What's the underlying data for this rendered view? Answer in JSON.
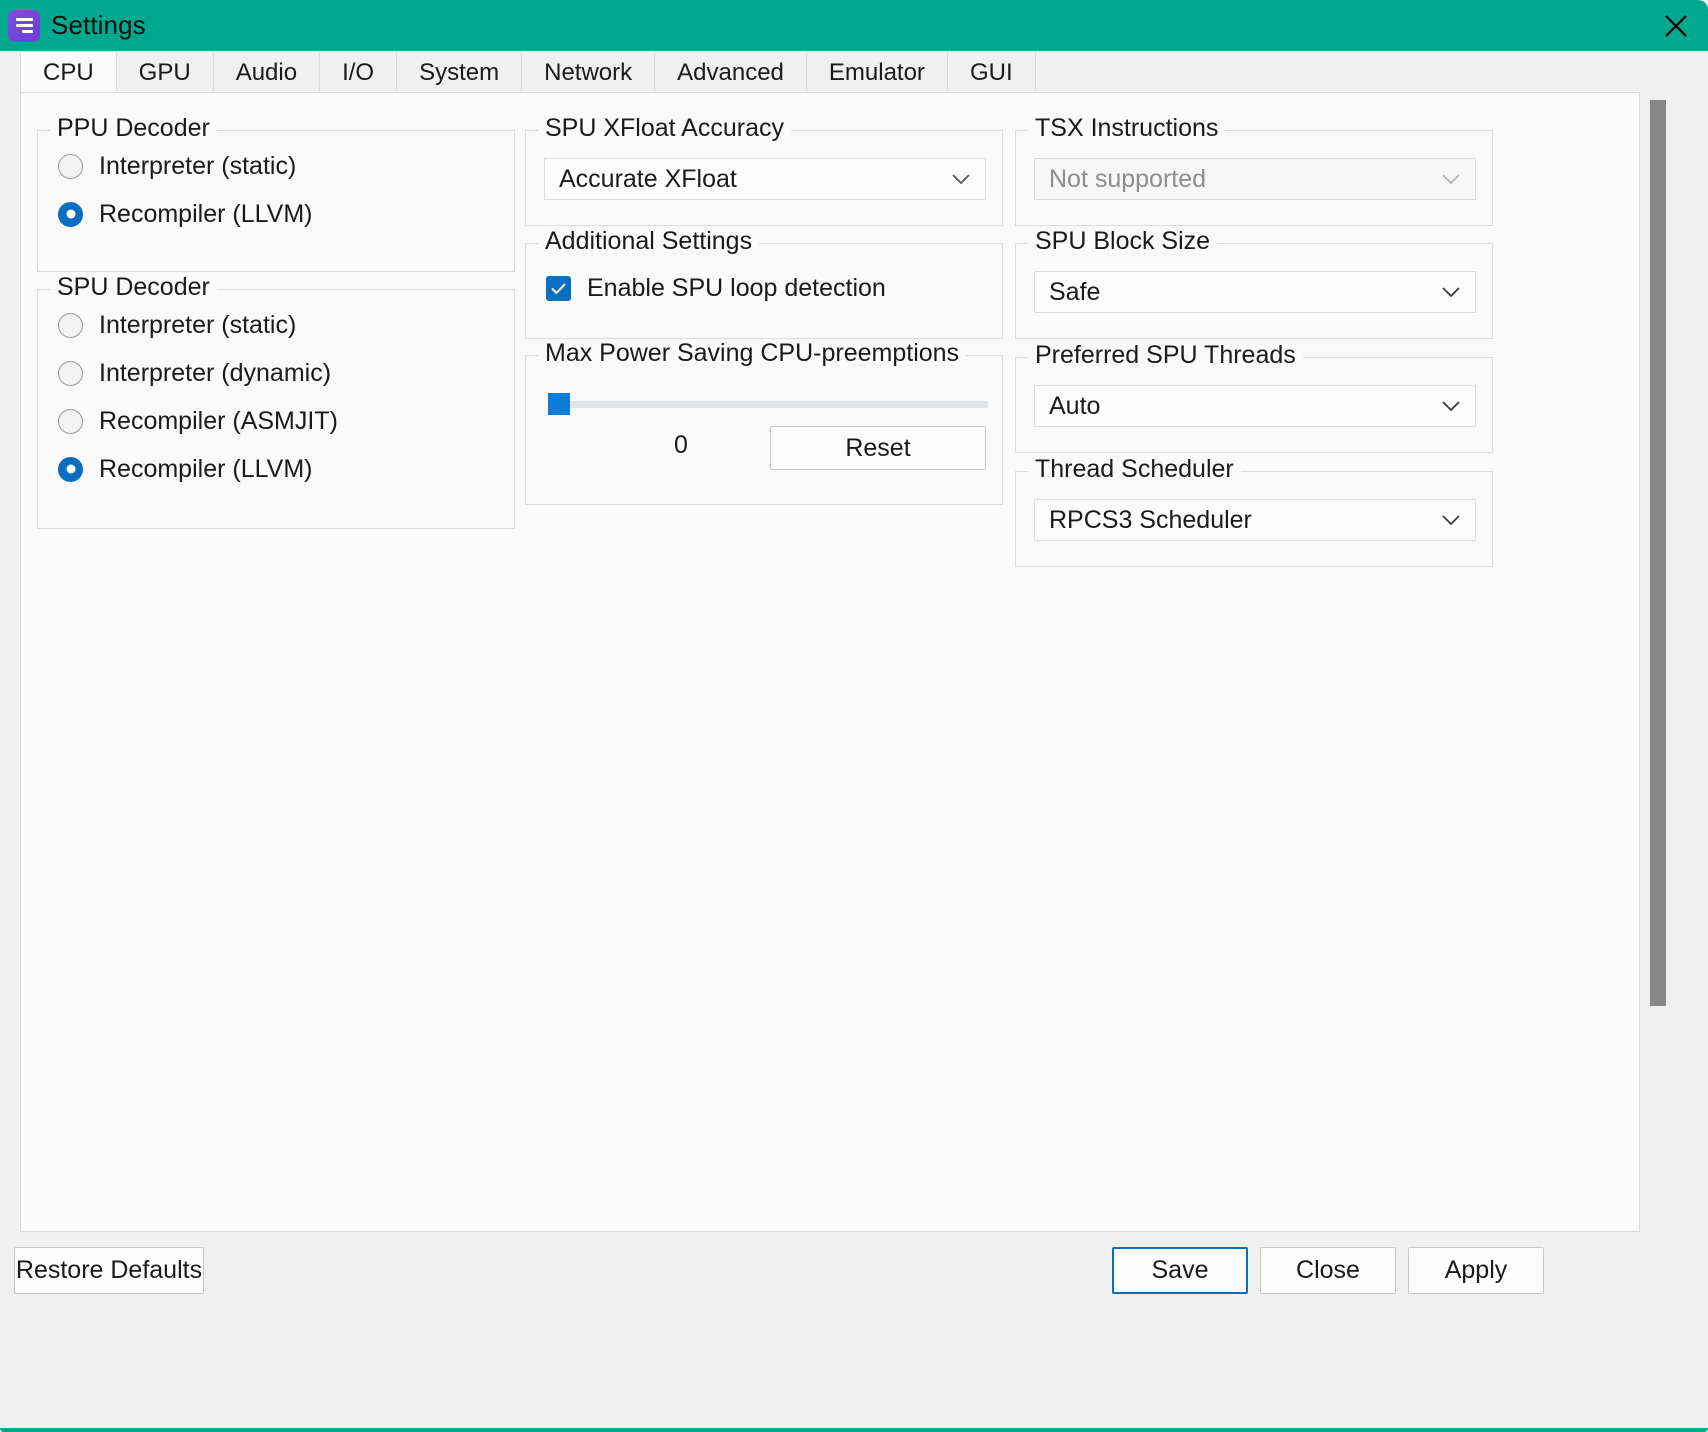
{
  "window": {
    "title": "Settings",
    "accent_color": "#00a88e",
    "app_icon": "rpcs3-menu-icon",
    "close_icon": "close-icon"
  },
  "tabs": [
    {
      "label": "CPU",
      "active": true
    },
    {
      "label": "GPU",
      "active": false
    },
    {
      "label": "Audio",
      "active": false
    },
    {
      "label": "I/O",
      "active": false
    },
    {
      "label": "System",
      "active": false
    },
    {
      "label": "Network",
      "active": false
    },
    {
      "label": "Advanced",
      "active": false
    },
    {
      "label": "Emulator",
      "active": false
    },
    {
      "label": "GUI",
      "active": false
    }
  ],
  "groups": {
    "ppu_decoder": {
      "title": "PPU Decoder",
      "options": [
        {
          "label": "Interpreter (static)",
          "checked": false
        },
        {
          "label": "Recompiler (LLVM)",
          "checked": true
        }
      ]
    },
    "spu_decoder": {
      "title": "SPU Decoder",
      "options": [
        {
          "label": "Interpreter (static)",
          "checked": false
        },
        {
          "label": "Interpreter (dynamic)",
          "checked": false
        },
        {
          "label": "Recompiler (ASMJIT)",
          "checked": false
        },
        {
          "label": "Recompiler (LLVM)",
          "checked": true
        }
      ]
    },
    "spu_xfloat_accuracy": {
      "title": "SPU XFloat Accuracy",
      "value": "Accurate XFloat",
      "enabled": true
    },
    "additional_settings": {
      "title": "Additional Settings",
      "checkbox_label": "Enable SPU loop detection",
      "checkbox_checked": true
    },
    "max_power_saving": {
      "title": "Max Power Saving CPU-preemptions",
      "slider_value": "0",
      "slider_percent": 0,
      "reset_label": "Reset"
    },
    "tsx_instructions": {
      "title": "TSX Instructions",
      "value": "Not supported",
      "enabled": false
    },
    "spu_block_size": {
      "title": "SPU Block Size",
      "value": "Safe",
      "enabled": true
    },
    "preferred_spu_threads": {
      "title": "Preferred SPU Threads",
      "value": "Auto",
      "enabled": true
    },
    "thread_scheduler": {
      "title": "Thread Scheduler",
      "value": "RPCS3 Scheduler",
      "enabled": true
    }
  },
  "footer": {
    "restore_defaults": "Restore Defaults",
    "save": "Save",
    "close": "Close",
    "apply": "Apply"
  },
  "colors": {
    "titlebar": "#00a88e",
    "accent_blue": "#0a6ec1",
    "slider_blue": "#0a7bd8",
    "scrollbar_thumb": "#878787"
  }
}
